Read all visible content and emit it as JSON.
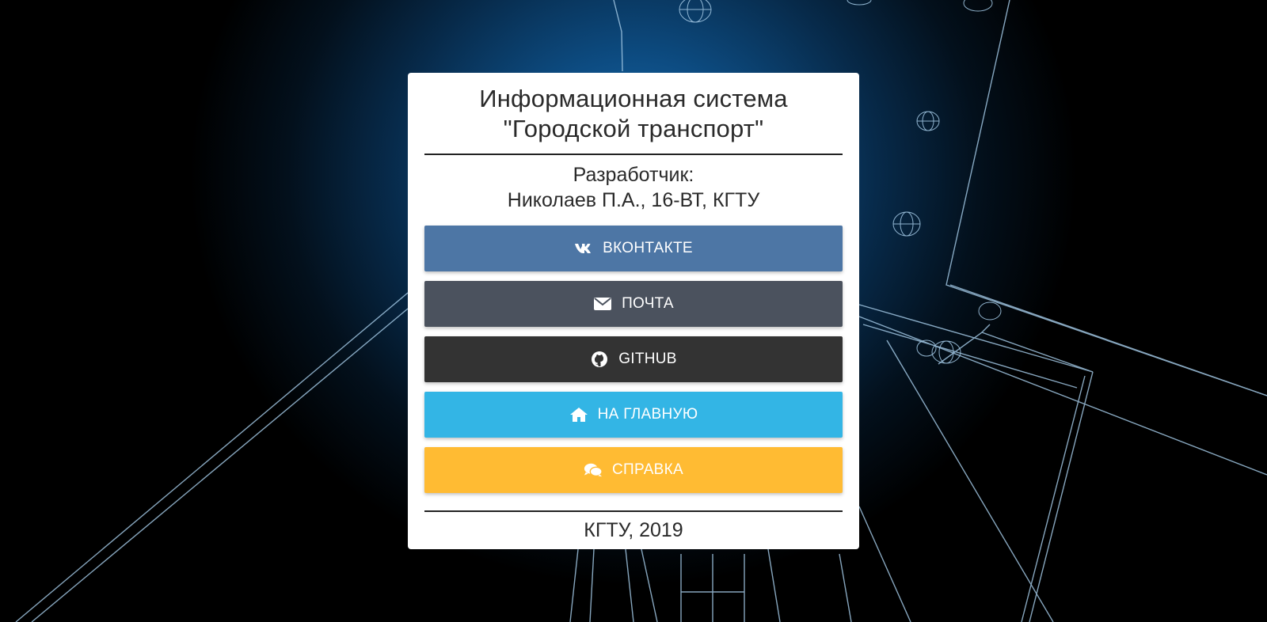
{
  "header": {
    "title_line1": "Информационная система",
    "title_line2": "\"Городской транспорт\""
  },
  "developer": {
    "label": "Разработчик:",
    "value": "Николаев П.А., 16-ВТ, КГТУ"
  },
  "buttons": [
    {
      "label": "ВКОНТАКТЕ",
      "icon": "vk-icon",
      "color": "#4d76a5"
    },
    {
      "label": "ПОЧТА",
      "icon": "envelope-icon",
      "color": "#4b525e"
    },
    {
      "label": "GITHUB",
      "icon": "github-icon",
      "color": "#333333"
    },
    {
      "label": "НА ГЛАВНУЮ",
      "icon": "home-icon",
      "color": "#33b5e5"
    },
    {
      "label": "СПРАВКА",
      "icon": "comments-icon",
      "color": "#ffbb33"
    }
  ],
  "footer": {
    "text": "КГТУ, 2019"
  }
}
